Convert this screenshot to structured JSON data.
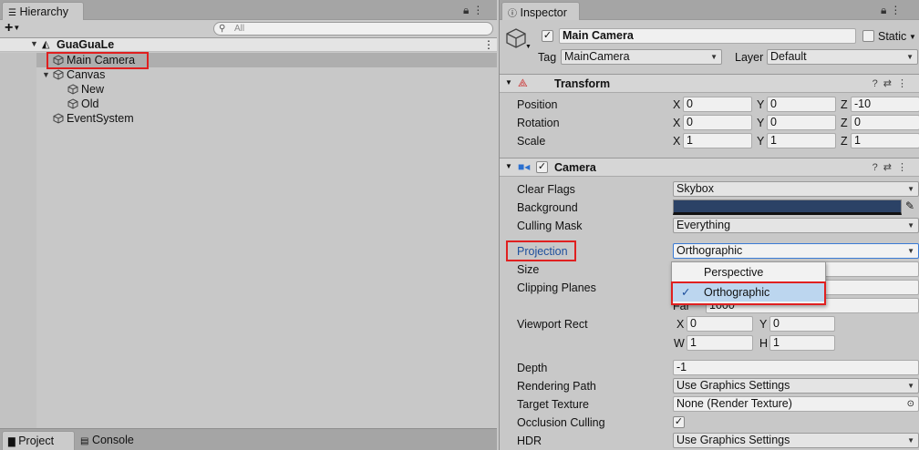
{
  "hierarchy": {
    "tab_label": "Hierarchy",
    "add_label": "+",
    "search_placeholder": "All",
    "scene_name": "GuaGuaLe",
    "items": [
      {
        "label": "Main Camera"
      },
      {
        "label": "Canvas"
      },
      {
        "label": "New"
      },
      {
        "label": "Old"
      },
      {
        "label": "EventSystem"
      }
    ]
  },
  "bottom_tabs": {
    "project": "Project",
    "console": "Console"
  },
  "inspector": {
    "tab_label": "Inspector",
    "object_name": "Main Camera",
    "static_label": "Static",
    "tag_label": "Tag",
    "tag_value": "MainCamera",
    "layer_label": "Layer",
    "layer_value": "Default",
    "transform": {
      "title": "Transform",
      "rows": [
        {
          "label": "Position",
          "x": "0",
          "y": "0",
          "z": "-10"
        },
        {
          "label": "Rotation",
          "x": "0",
          "y": "0",
          "z": "0"
        },
        {
          "label": "Scale",
          "x": "1",
          "y": "1",
          "z": "1"
        }
      ],
      "axis_x": "X",
      "axis_y": "Y",
      "axis_z": "Z"
    },
    "camera": {
      "title": "Camera",
      "clear_flags_label": "Clear Flags",
      "clear_flags_value": "Skybox",
      "background_label": "Background",
      "background_color": "#2b4266",
      "culling_mask_label": "Culling Mask",
      "culling_mask_value": "Everything",
      "projection_label": "Projection",
      "projection_value": "Orthographic",
      "size_label": "Size",
      "clipping_label": "Clipping Planes",
      "far_label": "Far",
      "far_value": "1000",
      "viewport_label": "Viewport Rect",
      "vp_x_label": "X",
      "vp_x": "0",
      "vp_y_label": "Y",
      "vp_y": "0",
      "vp_w_label": "W",
      "vp_w": "1",
      "vp_h_label": "H",
      "vp_h": "1",
      "depth_label": "Depth",
      "depth_value": "-1",
      "rendering_path_label": "Rendering Path",
      "rendering_path_value": "Use Graphics Settings",
      "target_texture_label": "Target Texture",
      "target_texture_value": "None (Render Texture)",
      "occlusion_label": "Occlusion Culling",
      "hdr_label": "HDR",
      "hdr_value": "Use Graphics Settings"
    },
    "projection_popup": {
      "options": [
        "Perspective",
        "Orthographic"
      ],
      "selected": "Orthographic"
    }
  },
  "colors": {
    "highlight_red": "#e02020",
    "label_blue": "#1d4f9c",
    "popup_highlight": "#bcd6ef"
  }
}
